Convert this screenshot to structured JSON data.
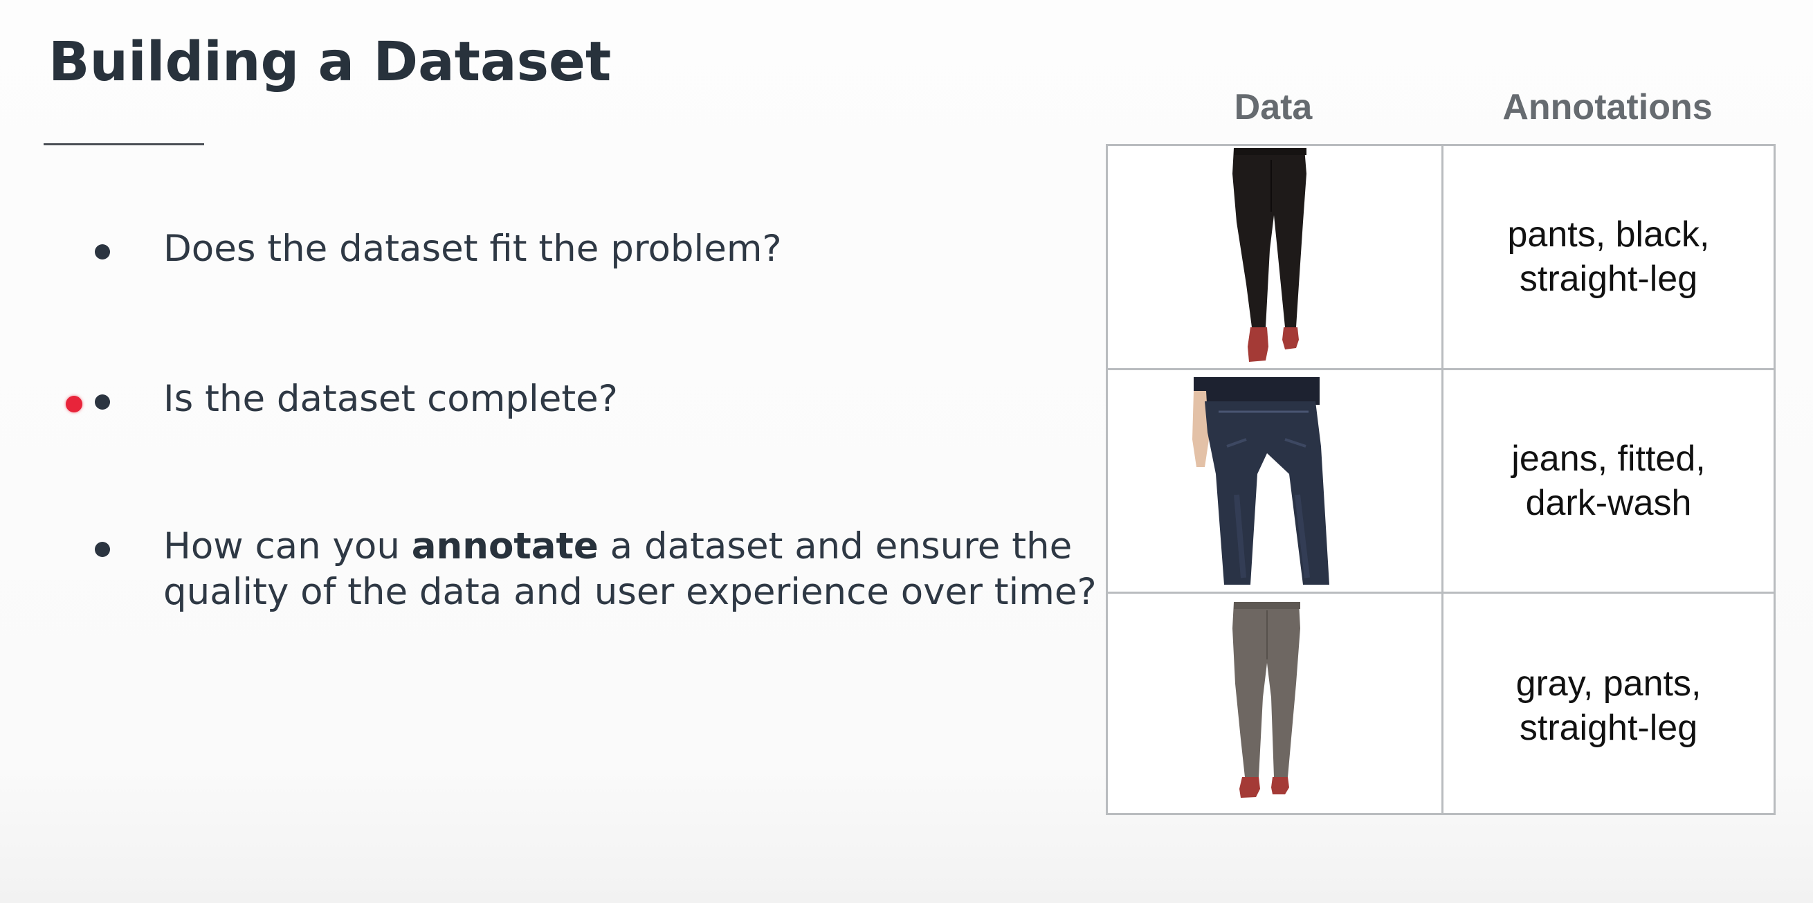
{
  "slide": {
    "title": "Building a Dataset",
    "bullets": [
      {
        "text_before": "Does the dataset fit the problem?",
        "bold": "",
        "text_after": "",
        "line2": ""
      },
      {
        "text_before": "Is the dataset complete?",
        "bold": "",
        "text_after": "",
        "line2": ""
      },
      {
        "text_before": "How can you ",
        "bold": "annotate",
        "text_after": " a dataset and ensure the",
        "line2": "quality of the data and user experience over time?"
      }
    ]
  },
  "table": {
    "headers": {
      "data": "Data",
      "annotations": "Annotations"
    },
    "rows": [
      {
        "image": "black-straight-leg-pants-photo",
        "annotation_line1": "pants, black,",
        "annotation_line2": "straight-leg"
      },
      {
        "image": "dark-wash-fitted-jeans-photo",
        "annotation_line1": "jeans, fitted,",
        "annotation_line2": "dark-wash"
      },
      {
        "image": "gray-straight-leg-pants-photo",
        "annotation_line1": "gray, pants,",
        "annotation_line2": "straight-leg"
      }
    ]
  },
  "colors": {
    "title": "#28323c",
    "text": "#2e3844",
    "header": "#666b70",
    "grid": "#b9bcbf",
    "pointer": "#e8243a",
    "black_pants": "#1e1a19",
    "jeans": "#2a3346",
    "gray_pants": "#6e6762",
    "shoes": "#a43a36"
  }
}
